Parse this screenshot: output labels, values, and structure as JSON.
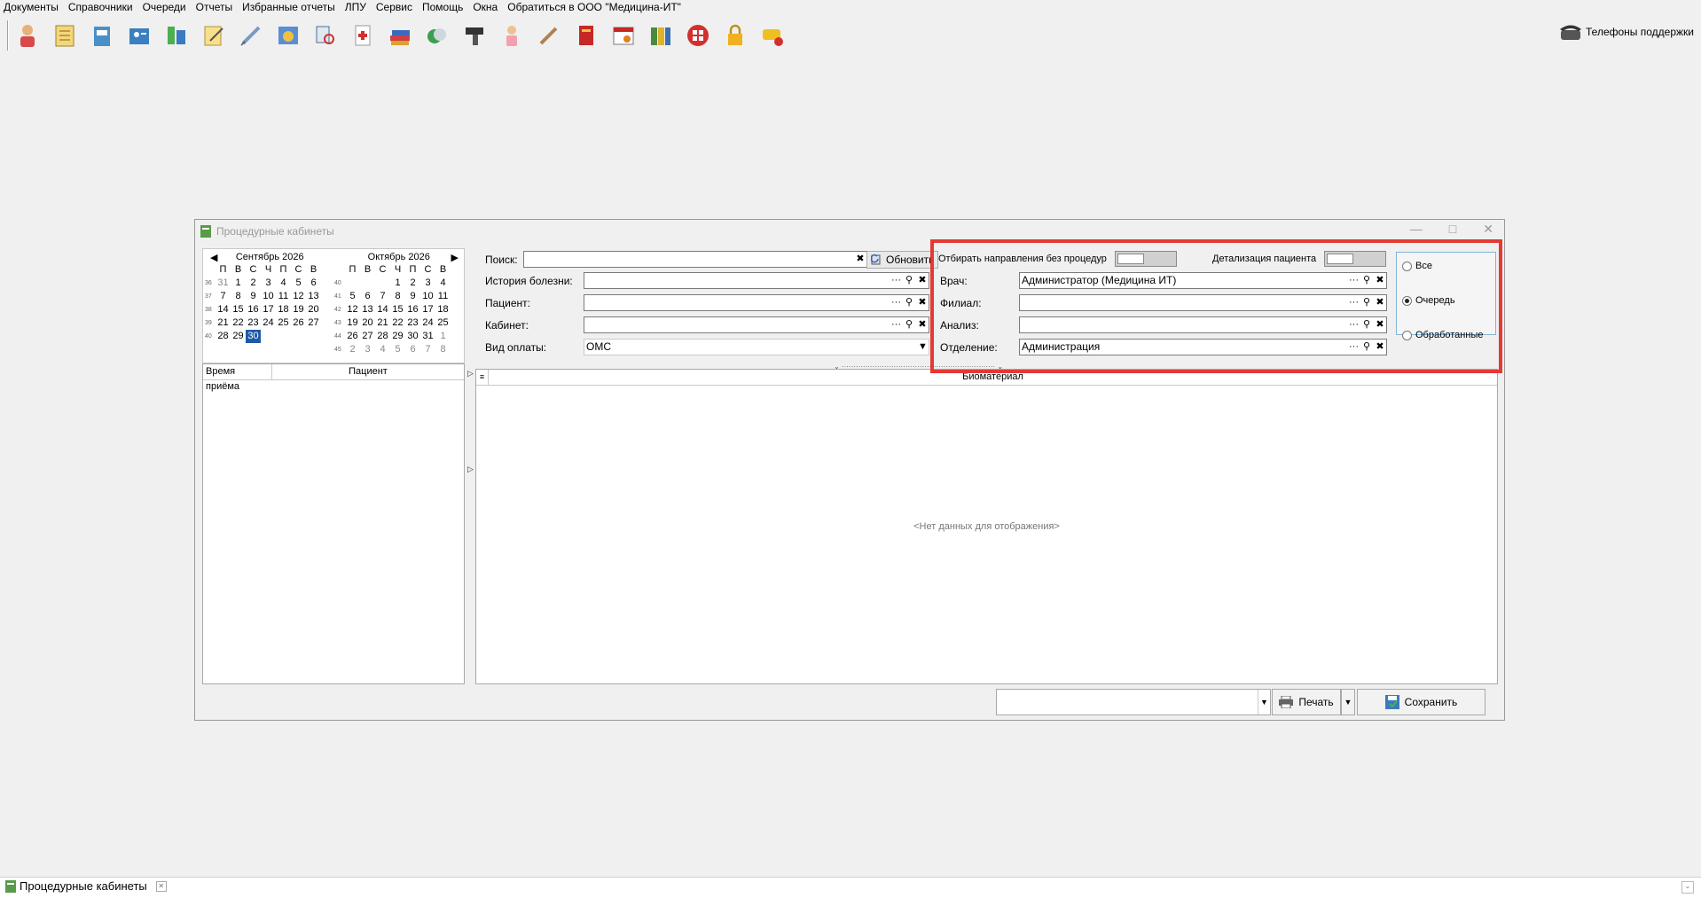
{
  "menu": [
    "Документы",
    "Справочники",
    "Очереди",
    "Отчеты",
    "Избранные отчеты",
    "ЛПУ",
    "Сервис",
    "Помощь",
    "Окна",
    "Обратиться в ООО \"Медицина-ИТ\""
  ],
  "toolbar": {
    "icons": [
      "doctor-icon",
      "notebook-icon",
      "folder-icon",
      "contact-card-icon",
      "blocks-icon",
      "notepad-icon",
      "syringe-icon",
      "calendar-clock-icon",
      "medical-search-icon",
      "medical-card-icon",
      "books-icon",
      "pills-icon",
      "barcode-scanner-icon",
      "nurse-icon",
      "pencil-icon",
      "red-book-icon",
      "calendar-settings-icon",
      "binders-icon",
      "red-grid-icon",
      "lock-icon",
      "notification-icon"
    ],
    "support_label": "Телефоны поддержки"
  },
  "window": {
    "title": "Процедурные кабинеты"
  },
  "calendar": {
    "weekdays": [
      "П",
      "В",
      "С",
      "Ч",
      "П",
      "С",
      "В"
    ],
    "left": {
      "month": "Сентябрь 2026",
      "weeks": [
        {
          "wk": "36",
          "days": [
            "31",
            "1",
            "2",
            "3",
            "4",
            "5",
            "6"
          ]
        },
        {
          "wk": "37",
          "days": [
            "7",
            "8",
            "9",
            "10",
            "11",
            "12",
            "13"
          ]
        },
        {
          "wk": "38",
          "days": [
            "14",
            "15",
            "16",
            "17",
            "18",
            "19",
            "20"
          ]
        },
        {
          "wk": "39",
          "days": [
            "21",
            "22",
            "23",
            "24",
            "25",
            "26",
            "27"
          ]
        },
        {
          "wk": "40",
          "days": [
            "28",
            "29",
            "30",
            "",
            "",
            "",
            ""
          ]
        }
      ]
    },
    "right": {
      "month": "Октябрь 2026",
      "weeks": [
        {
          "wk": "40",
          "days": [
            "",
            "",
            "",
            "1",
            "2",
            "3",
            "4"
          ]
        },
        {
          "wk": "41",
          "days": [
            "5",
            "6",
            "7",
            "8",
            "9",
            "10",
            "11"
          ]
        },
        {
          "wk": "42",
          "days": [
            "12",
            "13",
            "14",
            "15",
            "16",
            "17",
            "18"
          ]
        },
        {
          "wk": "43",
          "days": [
            "19",
            "20",
            "21",
            "22",
            "23",
            "24",
            "25"
          ]
        },
        {
          "wk": "44",
          "days": [
            "26",
            "27",
            "28",
            "29",
            "30",
            "31",
            "1"
          ]
        },
        {
          "wk": "45",
          "days": [
            "2",
            "3",
            "4",
            "5",
            "6",
            "7",
            "8"
          ]
        }
      ]
    },
    "selected": "30"
  },
  "list": {
    "col_time": "Время приёма",
    "col_patient": "Пациент"
  },
  "form": {
    "search_label": "Поиск:",
    "search_value": "",
    "refresh_label": "Обновить",
    "history_label": "История болезни:",
    "history_value": "",
    "patient_label": "Пациент:",
    "patient_value": "",
    "cabinet_label": "Кабинет:",
    "cabinet_value": "",
    "payment_label": "Вид оплаты:",
    "payment_value": "ОМС",
    "no_proc_label": "Отбирать направления без процедур",
    "detail_label": "Детализация пациента",
    "doctor_label": "Врач:",
    "doctor_value": "Администратор (Медицина ИТ)",
    "branch_label": "Филиал:",
    "branch_value": "",
    "analysis_label": "Анализ:",
    "analysis_value": "",
    "department_label": "Отделение:",
    "department_value": "Администрация"
  },
  "filter": {
    "all": "Все",
    "queue": "Очередь",
    "processed": "Обработанные",
    "selected": "queue"
  },
  "grid": {
    "col_biomaterial": "Биоматериал",
    "empty": "<Нет данных для отображения>"
  },
  "bottom": {
    "print_label": "Печать",
    "save_label": "Сохранить",
    "select_value": ""
  },
  "taskbar": {
    "tab_label": "Процедурные кабинеты"
  }
}
